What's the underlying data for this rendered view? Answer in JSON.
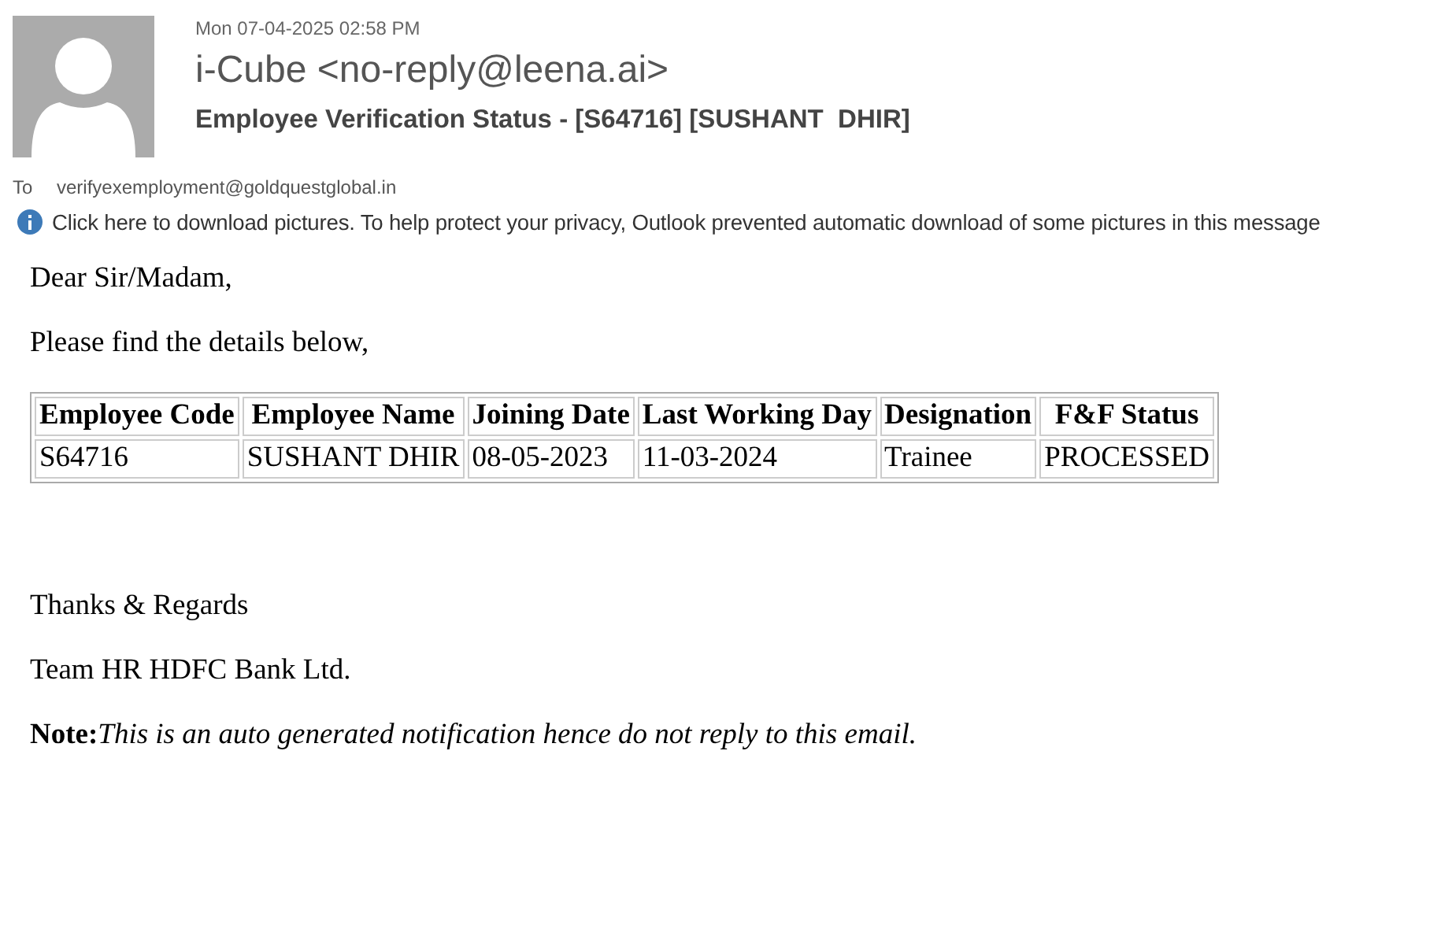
{
  "header": {
    "date": "Mon 07-04-2025 02:58 PM",
    "sender": "i-Cube <no-reply@leena.ai>",
    "subject": "Employee Verification Status - [S64716] [SUSHANT  DHIR]",
    "to_label": "To",
    "to": "verifyexemployment@goldquestglobal.in",
    "info_bar": "Click here to download pictures. To help protect your privacy, Outlook prevented automatic download of some pictures in this message"
  },
  "body": {
    "greeting": "Dear Sir/Madam,",
    "intro": "Please find the details below,",
    "table": {
      "columns": [
        "Employee Code",
        "Employee Name",
        "Joining Date",
        "Last Working Day",
        "Designation",
        "F&F Status"
      ],
      "rows": [
        [
          "S64716",
          "SUSHANT DHIR",
          "08-05-2023",
          "11-03-2024",
          "Trainee",
          "PROCESSED"
        ]
      ]
    },
    "closing": "Thanks & Regards",
    "team": "Team HR HDFC Bank Ltd.",
    "note_label": "Note:",
    "note": "This is an auto generated notification hence do not reply to this email."
  }
}
